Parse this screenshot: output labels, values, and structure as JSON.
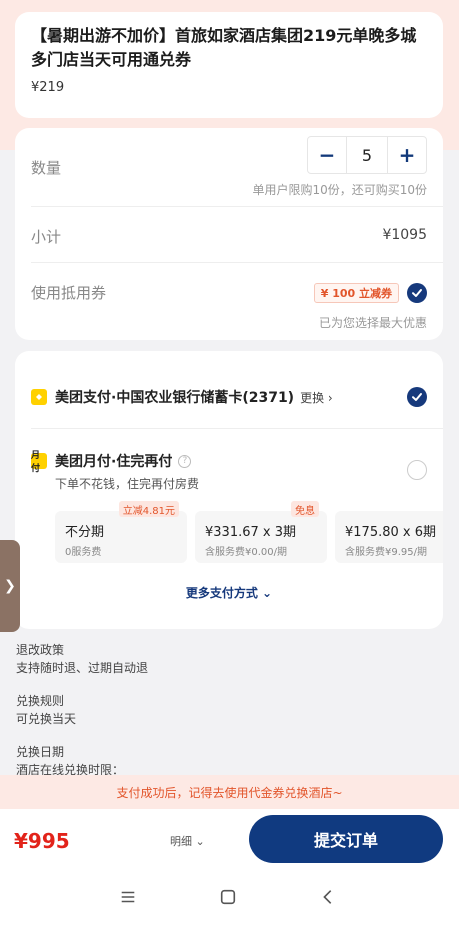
{
  "product": {
    "title": "【暑期出游不加价】首旅如家酒店集团219元单晚多城多门店当天可用通兑券",
    "price": "¥219"
  },
  "order": {
    "quantity_label": "数量",
    "quantity_value": "5",
    "minus": "−",
    "plus": "+",
    "limit_note": "单用户限购10份，还可购买10份",
    "subtotal_label": "小计",
    "subtotal_value": "¥1095",
    "coupon_label": "使用抵用券",
    "coupon_tag": "¥ 100 立减券",
    "best_note": "已为您选择最大优惠"
  },
  "payment": {
    "option1_label": "美团支付·中国农业银行储蓄卡(2371)",
    "option1_change": "更换 ›",
    "option2_icon": "月付",
    "option2_label": "美团月付·住完再付",
    "option2_help": "?",
    "option2_sub": "下单不花钱，住完再付房费",
    "plans": [
      {
        "main": "不分期",
        "sub": "0服务费",
        "badge": "立减4.81元"
      },
      {
        "main": "¥331.67 x 3期",
        "sub": "含服务费¥0.00/期",
        "badge": "免息"
      },
      {
        "main": "¥175.80 x 6期",
        "sub": "含服务费¥9.95/期",
        "badge": ""
      }
    ],
    "more_label": "更多支付方式 ⌄"
  },
  "side_tab": "❯",
  "policies": [
    {
      "title": "退改政策",
      "text": "支持随时退、过期自动退"
    },
    {
      "title": "兑换规则",
      "text": "可兑换当天"
    },
    {
      "title": "兑换日期",
      "text": "酒店在线兑换时限："
    }
  ],
  "banner": "支付成功后，记得去使用代金券兑换酒店~",
  "bottom": {
    "total": "¥995",
    "detail": "明细 ⌄",
    "submit": "提交订单"
  },
  "nav": {
    "menu_icon": "menu-icon",
    "home_icon": "home-icon",
    "back_icon": "back-icon"
  },
  "colors": {
    "brand": "#103a80",
    "accent": "#e2552b",
    "price": "#e2231a"
  }
}
